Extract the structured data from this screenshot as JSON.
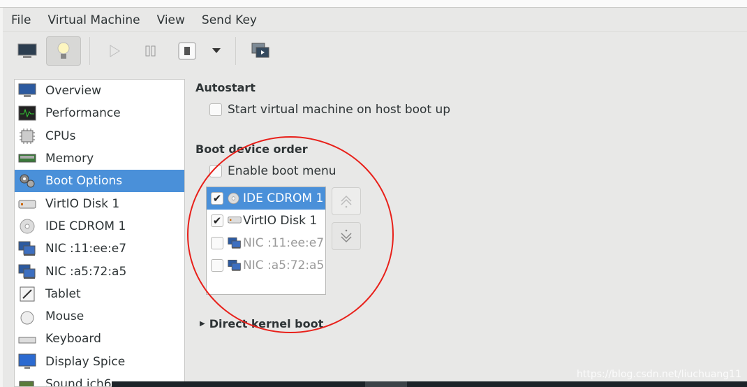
{
  "menu": [
    "File",
    "Virtual Machine",
    "View",
    "Send Key"
  ],
  "toolbar": {
    "icons": [
      "monitor-icon",
      "lightbulb-icon",
      "play-icon",
      "pause-icon",
      "power-icon",
      "dropdown-icon",
      "screenshot-icon"
    ]
  },
  "sidebar": {
    "items": [
      {
        "label": "Overview",
        "icon": "monitor-icon"
      },
      {
        "label": "Performance",
        "icon": "performance-icon"
      },
      {
        "label": "CPUs",
        "icon": "cpu-icon"
      },
      {
        "label": "Memory",
        "icon": "memory-icon"
      },
      {
        "label": "Boot Options",
        "icon": "gears-icon",
        "selected": true
      },
      {
        "label": "VirtIO Disk 1",
        "icon": "disk-icon"
      },
      {
        "label": "IDE CDROM 1",
        "icon": "cdrom-icon"
      },
      {
        "label": "NIC :11:ee:e7",
        "icon": "nic-icon"
      },
      {
        "label": "NIC :a5:72:a5",
        "icon": "nic-icon"
      },
      {
        "label": "Tablet",
        "icon": "tablet-icon"
      },
      {
        "label": "Mouse",
        "icon": "mouse-icon"
      },
      {
        "label": "Keyboard",
        "icon": "keyboard-icon"
      },
      {
        "label": "Display Spice",
        "icon": "display-icon"
      },
      {
        "label": "Sound ich6",
        "icon": "sound-icon"
      }
    ]
  },
  "autostart": {
    "title": "Autostart",
    "checkbox": "Start virtual machine on host boot up",
    "checked": false
  },
  "boot": {
    "title": "Boot device order",
    "menu_checkbox": "Enable boot menu",
    "menu_checked": false,
    "devices": [
      {
        "label": "IDE CDROM 1",
        "checked": true,
        "selected": true,
        "icon": "cdrom-icon"
      },
      {
        "label": "VirtIO Disk 1",
        "checked": true,
        "icon": "disk-icon"
      },
      {
        "label": "NIC :11:ee:e7",
        "checked": false,
        "disabled": true,
        "icon": "nic-icon"
      },
      {
        "label": "NIC :a5:72:a5",
        "checked": false,
        "disabled": true,
        "icon": "nic-icon"
      }
    ]
  },
  "kernel": {
    "title": "Direct kernel boot"
  },
  "watermark": "https://blog.csdn.net/liuchuang11",
  "colors": {
    "accent": "#4a90d9",
    "annotation": "#e8201a"
  }
}
